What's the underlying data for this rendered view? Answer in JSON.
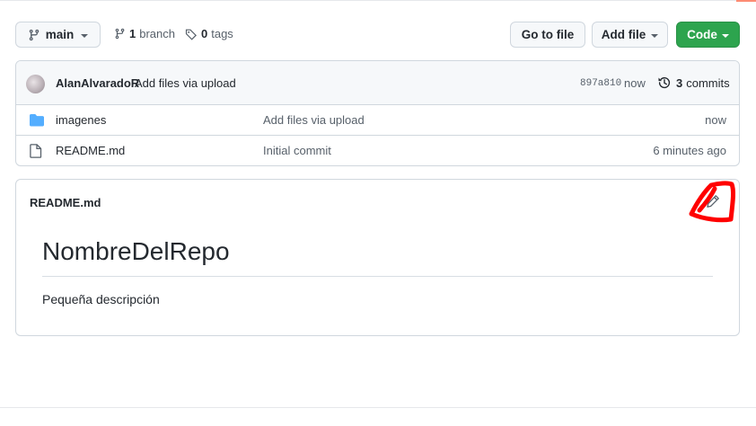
{
  "toolbar": {
    "branch_label": "main",
    "branch_count": "1",
    "branch_word": "branch",
    "tag_count": "0",
    "tag_word": "tags",
    "goto_label": "Go to file",
    "addfile_label": "Add file",
    "code_label": "Code"
  },
  "commit": {
    "author": "AlanAlvaradoR",
    "message": "Add files via upload",
    "sha": "897a810",
    "time": "now",
    "commits_count": "3",
    "commits_word": "commits"
  },
  "files": [
    {
      "name": "imagenes",
      "type": "folder",
      "message": "Add files via upload",
      "time": "now"
    },
    {
      "name": "README.md",
      "type": "file",
      "message": "Initial commit",
      "time": "6 minutes ago"
    }
  ],
  "readme": {
    "title": "README.md",
    "heading": "NombreDelRepo",
    "description": "Pequeña descripción"
  },
  "colors": {
    "accent_green": "#2da44e",
    "folder_blue": "#54aeff",
    "annotation_red": "#ff0000"
  },
  "icons": [
    "git-branch-icon",
    "tag-icon",
    "history-icon",
    "folder-icon",
    "file-icon",
    "pencil-icon"
  ]
}
